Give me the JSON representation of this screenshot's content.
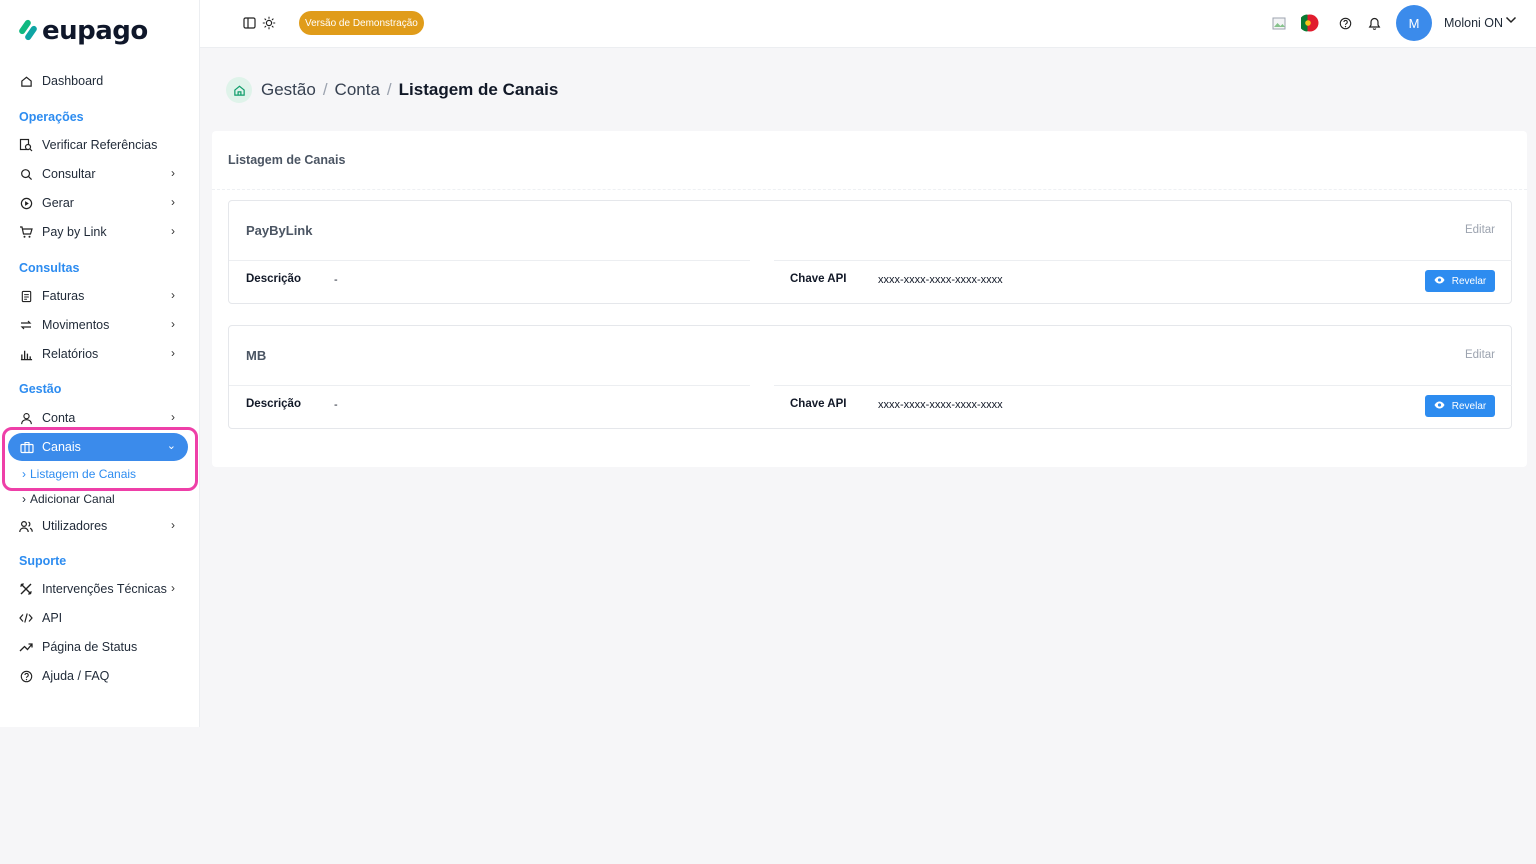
{
  "brand": {
    "name": "eupago"
  },
  "sidebar": {
    "dashboard": "Dashboard",
    "sections": {
      "operacoes": "Operações",
      "consultas": "Consultas",
      "gestao": "Gestão",
      "suporte": "Suporte"
    },
    "items": {
      "verificar": "Verificar Referências",
      "consultar": "Consultar",
      "gerar": "Gerar",
      "paybylink": "Pay by Link",
      "faturas": "Faturas",
      "movimentos": "Movimentos",
      "relatorios": "Relatórios",
      "conta": "Conta",
      "canais": "Canais",
      "listagem": "Listagem de Canais",
      "adicionar": "Adicionar Canal",
      "utilizadores": "Utilizadores",
      "intervencoes": "Intervenções Técnicas",
      "api": "API",
      "status": "Página de Status",
      "ajuda": "Ajuda / FAQ"
    }
  },
  "topbar": {
    "demo_badge": "Versão de Demonstração",
    "avatar_initial": "M",
    "user_name": "Moloni ON"
  },
  "breadcrumb": {
    "items": [
      "Gestão",
      "Conta"
    ],
    "current": "Listagem de Canais",
    "separator": "/"
  },
  "main": {
    "card_title": "Listagem de Canais",
    "edit_label": "Editar",
    "desc_label": "Descrição",
    "api_label": "Chave API",
    "reveal_label": "Revelar",
    "channels": [
      {
        "name": "PayByLink",
        "description": "-",
        "api_key": "xxxx-xxxx-xxxx-xxxx-xxxx"
      },
      {
        "name": "MB",
        "description": "-",
        "api_key": "xxxx-xxxx-xxxx-xxxx-xxxx"
      }
    ]
  },
  "colors": {
    "accent": "#3b8beb",
    "section": "#2d8cf0",
    "demo_badge": "#e09c1a",
    "highlight": "#ee3fa8"
  }
}
